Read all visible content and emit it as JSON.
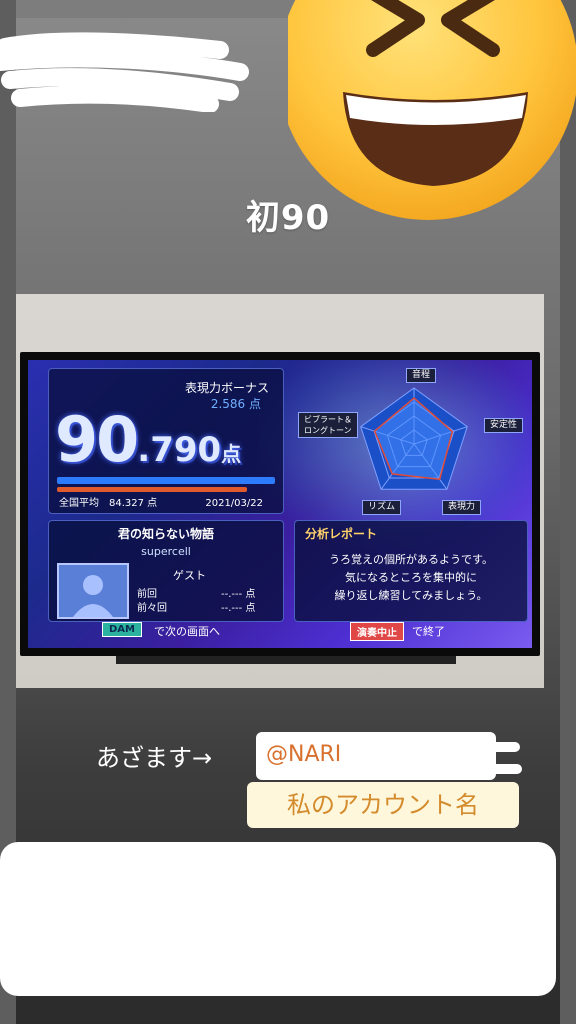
{
  "story": {
    "caption": "初90",
    "thanks": "あざます→",
    "mention": "@NARI",
    "account_label": "私のアカウント名"
  },
  "karaoke": {
    "bonus_label": "表現力ボーナス",
    "bonus_value": "2.586 点",
    "score_int": "90",
    "score_dec": ".790",
    "score_unit": "点",
    "national_avg": "全国平均　84.327 点",
    "date": "2021/03/22",
    "radar_labels": {
      "pitch": "音程",
      "stability": "安定性",
      "expression": "表現力",
      "rhythm": "リズム",
      "vibrato_l1": "ビブラート＆",
      "vibrato_l2": "ロングトーン"
    },
    "radar_values": [
      0.82,
      0.72,
      0.78,
      0.66,
      0.74
    ],
    "song_title": "君の知らない物語",
    "artist": "supercell",
    "guest": "ゲスト",
    "prev_label": "前回",
    "prev_value": "--.--- 点",
    "prev2_label": "前々回",
    "prev2_value": "--.--- 点",
    "report_title": "分析レポート",
    "report_lines": [
      "うろ覚えの個所があるようです。",
      "気になるところを集中的に",
      "繰り返し練習してみましょう。"
    ],
    "dam_label": "DAM",
    "dam_text": "で次の画面へ",
    "stop_label": "演奏中止",
    "stop_text": "で終了"
  },
  "colors": {
    "mention_text": "#d9712e",
    "account_text": "#d38b2c",
    "screen_blue": "#2a2fb0"
  },
  "icons": {
    "emoji": "grinning-squinting-face",
    "avatar": "person-silhouette-icon"
  }
}
